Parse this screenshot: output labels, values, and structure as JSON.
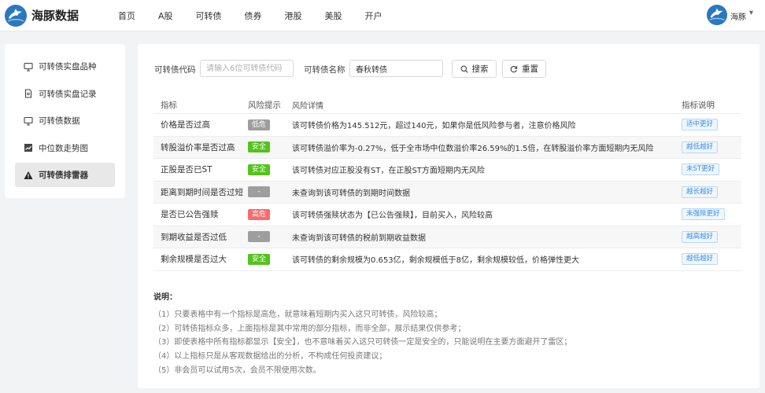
{
  "header": {
    "brand": "海豚数据",
    "nav": [
      "首页",
      "A股",
      "可转债",
      "债券",
      "港股",
      "美股",
      "开户"
    ],
    "username": "海豚",
    "caret": "▾"
  },
  "sidebar": {
    "items": [
      {
        "label": "可转债实盘品种",
        "icon": "monitor-icon"
      },
      {
        "label": "可转债实盘记录",
        "icon": "document-icon"
      },
      {
        "label": "可转债数据",
        "icon": "monitor-icon"
      },
      {
        "label": "中位数走势图",
        "icon": "chart-icon"
      },
      {
        "label": "可转债排雷器",
        "icon": "warning-icon",
        "active": true
      }
    ]
  },
  "search": {
    "code_label": "可转债代码",
    "code_placeholder": "请输入6位可转债代码",
    "code_value": "",
    "name_label": "可转债名称",
    "name_value": "春秋转债",
    "search_label": "搜索",
    "reset_label": "重置"
  },
  "table": {
    "headers": [
      "指标",
      "风险提示",
      "风险详情",
      "指标说明"
    ],
    "rows": [
      {
        "indicator": "价格是否过高",
        "risk": "低危",
        "risk_color": "#9e9e9e",
        "detail": "该可转债价格为145.512元，超过140元，如果你是低风险参与者，注意价格风险",
        "note": "适中更好"
      },
      {
        "indicator": "转股溢价率是否过高",
        "risk": "安全",
        "risk_color": "#52c41a",
        "detail": "该可转债溢价率为-0.27%，低于全市场中位数溢价率26.59%的1.5倍，在转股溢价率方面短期内无风险",
        "note": "越低越好"
      },
      {
        "indicator": "正股是否已ST",
        "risk": "安全",
        "risk_color": "#52c41a",
        "detail": "该可转债对应正股没有ST，在正股ST方面短期内无风险",
        "note": "未ST更好"
      },
      {
        "indicator": "距离到期时间是否过短",
        "risk": "-",
        "risk_color": "#9e9e9e",
        "detail": "未查询到该可转债的到期时间数据",
        "note": "越长越好"
      },
      {
        "indicator": "是否已公告强赎",
        "risk": "高危",
        "risk_color": "#f56c6c",
        "detail": "该可转债强赎状态为【已公告强赎】，目前买入，风险较高",
        "note": "未强赎更好"
      },
      {
        "indicator": "到期收益是否过低",
        "risk": "-",
        "risk_color": "#9e9e9e",
        "detail": "未查询到该可转债的税前到期收益数据",
        "note": "越高越好"
      },
      {
        "indicator": "剩余规模是否过大",
        "risk": "安全",
        "risk_color": "#52c41a",
        "detail": "该可转债的剩余规模为0.653亿，剩余规模低于8亿，剩余规模较低，价格弹性更大",
        "note": "越低越好"
      }
    ]
  },
  "notes": {
    "title": "说明：",
    "lines": [
      "（1）只要表格中有一个指标是高危，就意味着短期内买入这只可转债，风险较高；",
      "（2）可转债指标众多，上面指标是其中常用的部分指标，而非全部，展示结果仅供参考；",
      "（3）即使表格中所有指标都显示【安全】，也不意味着买入这只可转债一定是安全的，只能说明在主要方面避开了雷区；",
      "（4）以上指标只是从客观数据给出的分析，不构成任何投资建议；",
      "（5）非会员可以试用5次，会员不限使用次数。"
    ]
  }
}
